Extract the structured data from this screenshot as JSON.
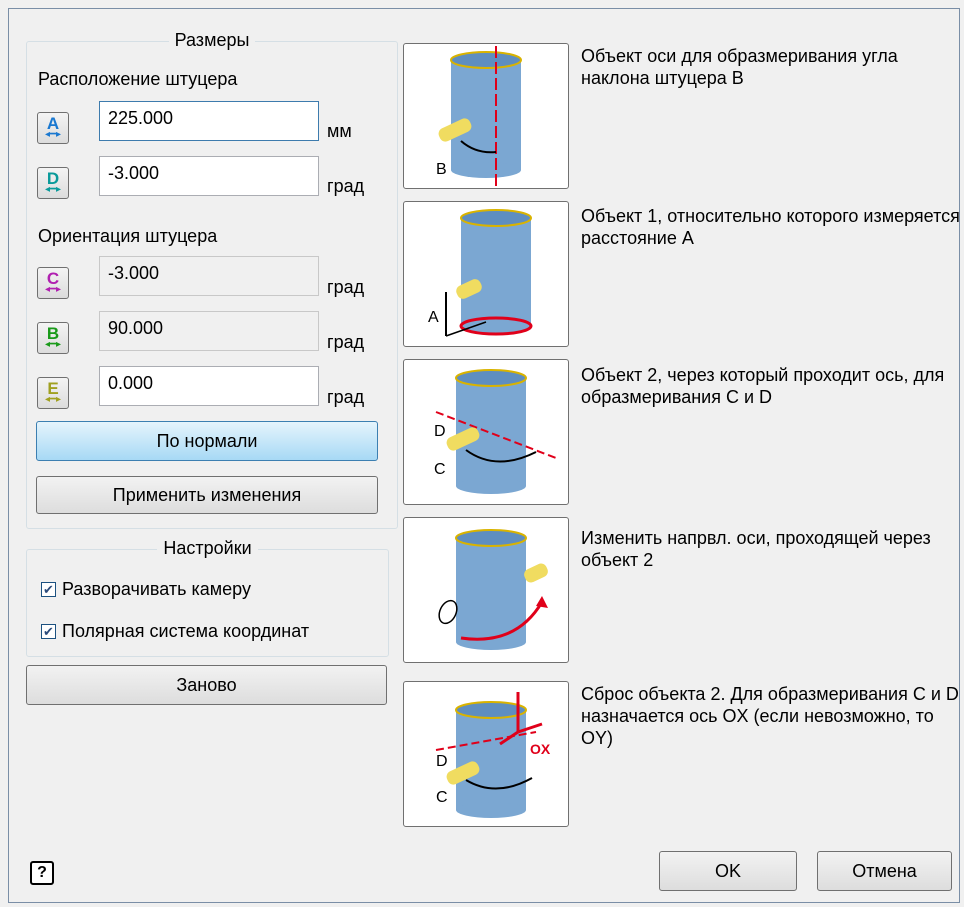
{
  "dimensions": {
    "title": "Размеры",
    "position_label": "Расположение штуцера",
    "orientation_label": "Ориентация штуцера",
    "rows": [
      {
        "letter": "A",
        "value": "225.000",
        "unit": "мм",
        "color": "#1a78d0",
        "enabled": true
      },
      {
        "letter": "D",
        "value": "-3.000",
        "unit": "град",
        "color": "#0a9a9a",
        "enabled": true
      },
      {
        "letter": "C",
        "value": "-3.000",
        "unit": "град",
        "color": "#b020b0",
        "enabled": false
      },
      {
        "letter": "B",
        "value": "90.000",
        "unit": "град",
        "color": "#1a9a1a",
        "enabled": false
      },
      {
        "letter": "E",
        "value": "0.000",
        "unit": "град",
        "color": "#a0a020",
        "enabled": true
      }
    ],
    "normal_button": "По нормали",
    "apply_button": "Применить изменения"
  },
  "settings": {
    "title": "Настройки",
    "rotate_camera": {
      "label": "Разворачивать камеру",
      "checked": true
    },
    "polar_coords": {
      "label": "Полярная система координат",
      "checked": true
    }
  },
  "reset_button": "Заново",
  "descriptions": [
    "Объект оси для образмеривания угла наклона штуцера B",
    "Объект 1, относительно которого измеряется расстояние A",
    "Объект 2, через который проходит ось, для образмеривания  C и D",
    "Изменить напрвл. оси, проходящей через объект 2",
    "Сброс объекта 2. Для образмеривания  C и D назначается ось OX (если невозможно, то OY)"
  ],
  "pic_labels": {
    "b": "B",
    "a": "A",
    "d": "D",
    "c": "C",
    "ox": "OX"
  },
  "footer": {
    "help_icon": "?",
    "ok": "OK",
    "cancel": "Отмена"
  },
  "colors": {
    "cylinder": "#7ba7d2",
    "rim": "#d9b300",
    "accent_red": "#e0001a",
    "nozzle": "#f0dc60"
  }
}
